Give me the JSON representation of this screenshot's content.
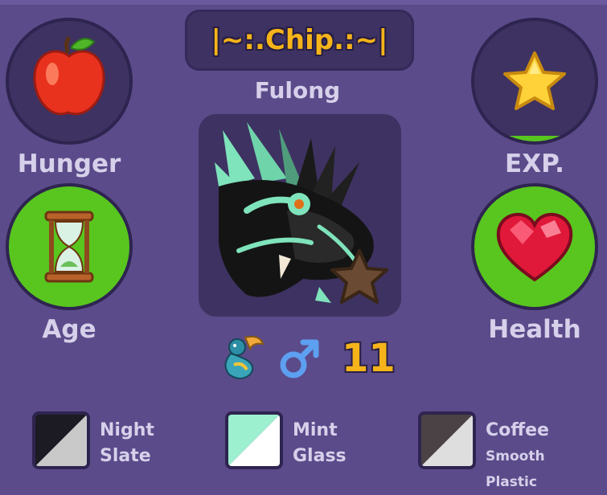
{
  "pet": {
    "name": "|~:.Chip.:~|",
    "species": "Fulong",
    "age_number": "11",
    "gender_icon": "male-symbol-icon",
    "breed_icon": "dragon-icon"
  },
  "stats": {
    "hunger": {
      "label": "Hunger",
      "icon": "apple-icon",
      "level": 0.0
    },
    "exp": {
      "label": "EXP.",
      "icon": "star-icon",
      "level": 0.05
    },
    "age": {
      "label": "Age",
      "icon": "hourglass-icon",
      "level": 1.0
    },
    "health": {
      "label": "Health",
      "icon": "heart-icon",
      "level": 1.0
    }
  },
  "colors": {
    "primary": {
      "line1": "Night",
      "line2": "Slate",
      "swatch_a": "#1c1a22",
      "swatch_b": "#c9c9c9"
    },
    "secondary": {
      "line1": "Mint",
      "line2": "Glass",
      "swatch_a": "#9df0cf",
      "swatch_b": "#ffffff"
    },
    "tertiary": {
      "line1": "Coffee",
      "line2": "Smooth Plastic",
      "swatch_a": "#4a4244",
      "swatch_b": "#dedede"
    }
  },
  "theme": {
    "panel": "#5b4b8a",
    "circle": "#3d3261",
    "fill_green": "#58c61e",
    "gold": "#f6b41a"
  }
}
